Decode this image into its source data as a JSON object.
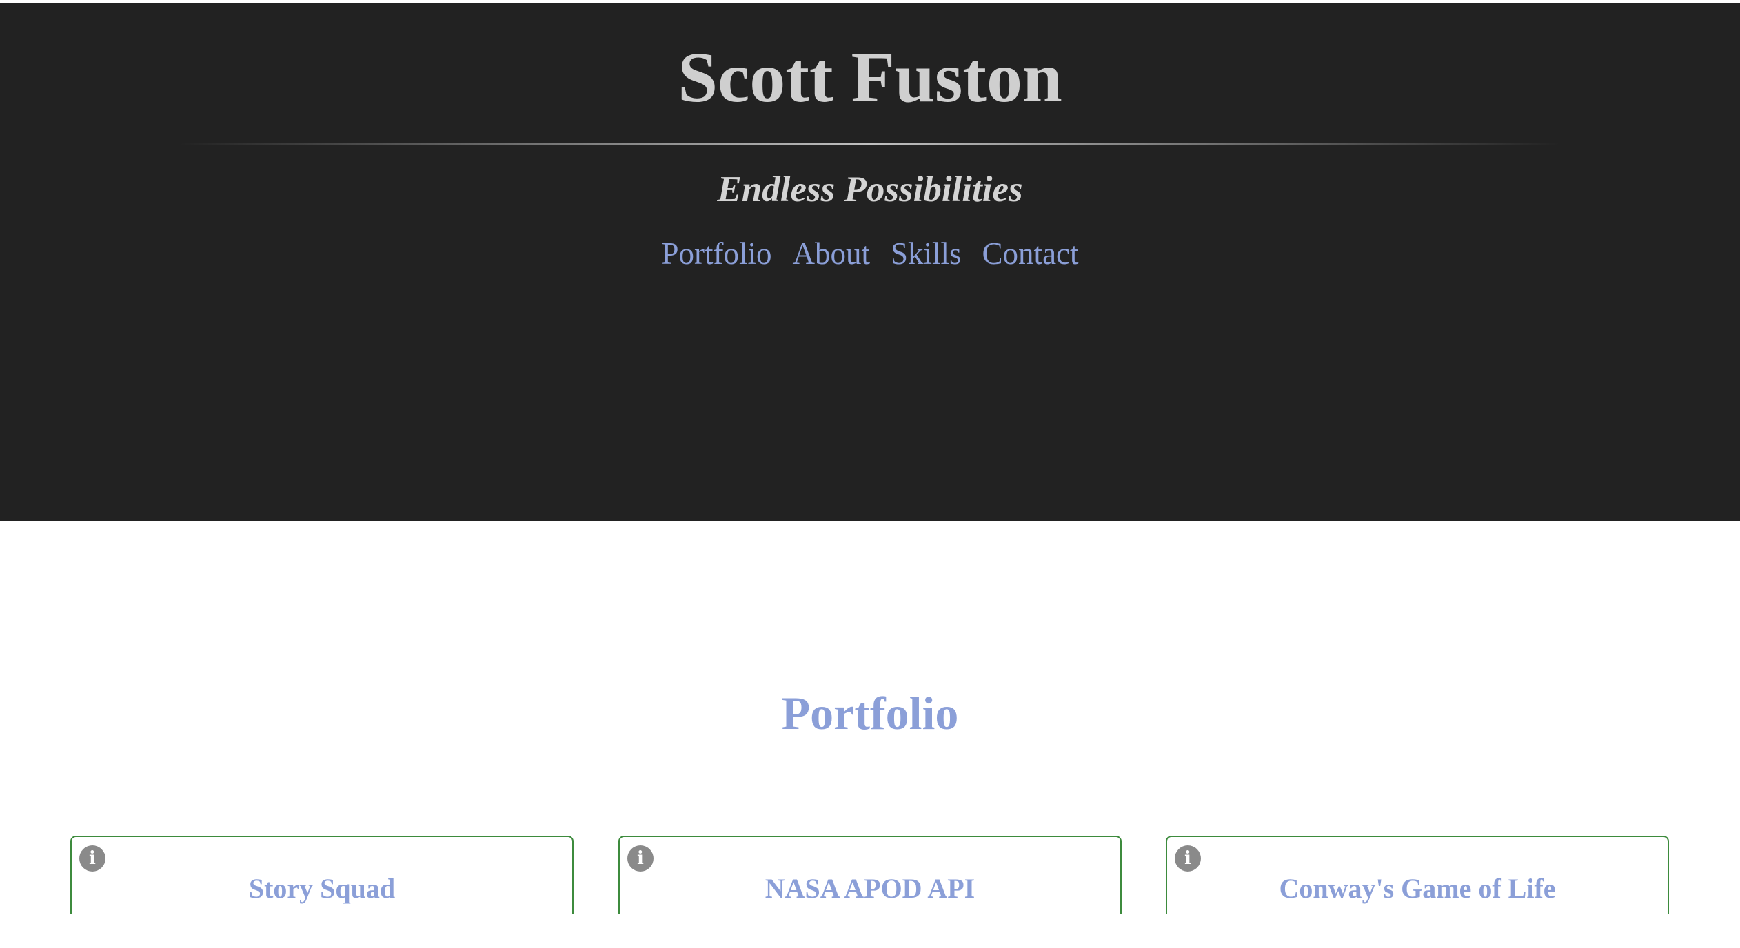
{
  "hero": {
    "title": "Scott Fuston",
    "tagline": "Endless Possibilities",
    "nav": [
      {
        "label": "Portfolio"
      },
      {
        "label": "About"
      },
      {
        "label": "Skills"
      },
      {
        "label": "Contact"
      }
    ]
  },
  "portfolio": {
    "heading": "Portfolio",
    "cards": [
      {
        "title": "Story Squad",
        "icon": "info-icon"
      },
      {
        "title": "NASA APOD API",
        "icon": "info-icon"
      },
      {
        "title": "Conway's Game of Life",
        "icon": "info-icon"
      }
    ]
  },
  "colors": {
    "hero_background": "#222222",
    "link": "#8b9fd8",
    "card_border": "#3d8b3d"
  }
}
